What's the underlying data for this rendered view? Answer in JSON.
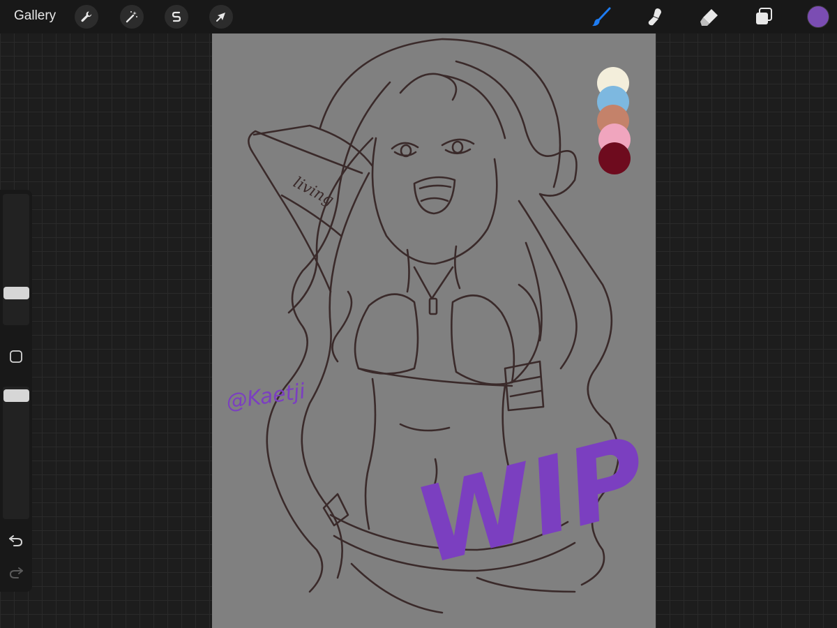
{
  "toolbar": {
    "gallery_label": "Gallery",
    "left_tools": [
      {
        "name": "actions",
        "icon": "wrench-icon"
      },
      {
        "name": "adjustments",
        "icon": "magic-wand-icon"
      },
      {
        "name": "selection",
        "icon": "selection-s-icon"
      },
      {
        "name": "transform",
        "icon": "arrow-cursor-icon"
      }
    ],
    "right_tools": [
      {
        "name": "brush",
        "icon": "brush-icon",
        "active": true
      },
      {
        "name": "smudge",
        "icon": "smudge-icon",
        "active": false
      },
      {
        "name": "eraser",
        "icon": "eraser-icon",
        "active": false
      },
      {
        "name": "layers",
        "icon": "layers-icon",
        "active": false
      }
    ],
    "current_color": "#7b4db3",
    "active_tool_color": "#1e7cf2"
  },
  "sidebar": {
    "brush_size_level": 0.22,
    "opacity_level": 1.0,
    "undo_icon": "undo-icon",
    "redo_icon": "redo-icon"
  },
  "artwork": {
    "background_color": "#808080",
    "line_color": "#3a2a2a",
    "accent_color": "#7b3fc0",
    "signature_text": "@Kaetji",
    "watermark_text": "WIP",
    "tattoo_text": "living",
    "palette": [
      "#f3eedb",
      "#7db8e0",
      "#c4826a",
      "#f0a5be",
      "#6e0b1e"
    ]
  }
}
